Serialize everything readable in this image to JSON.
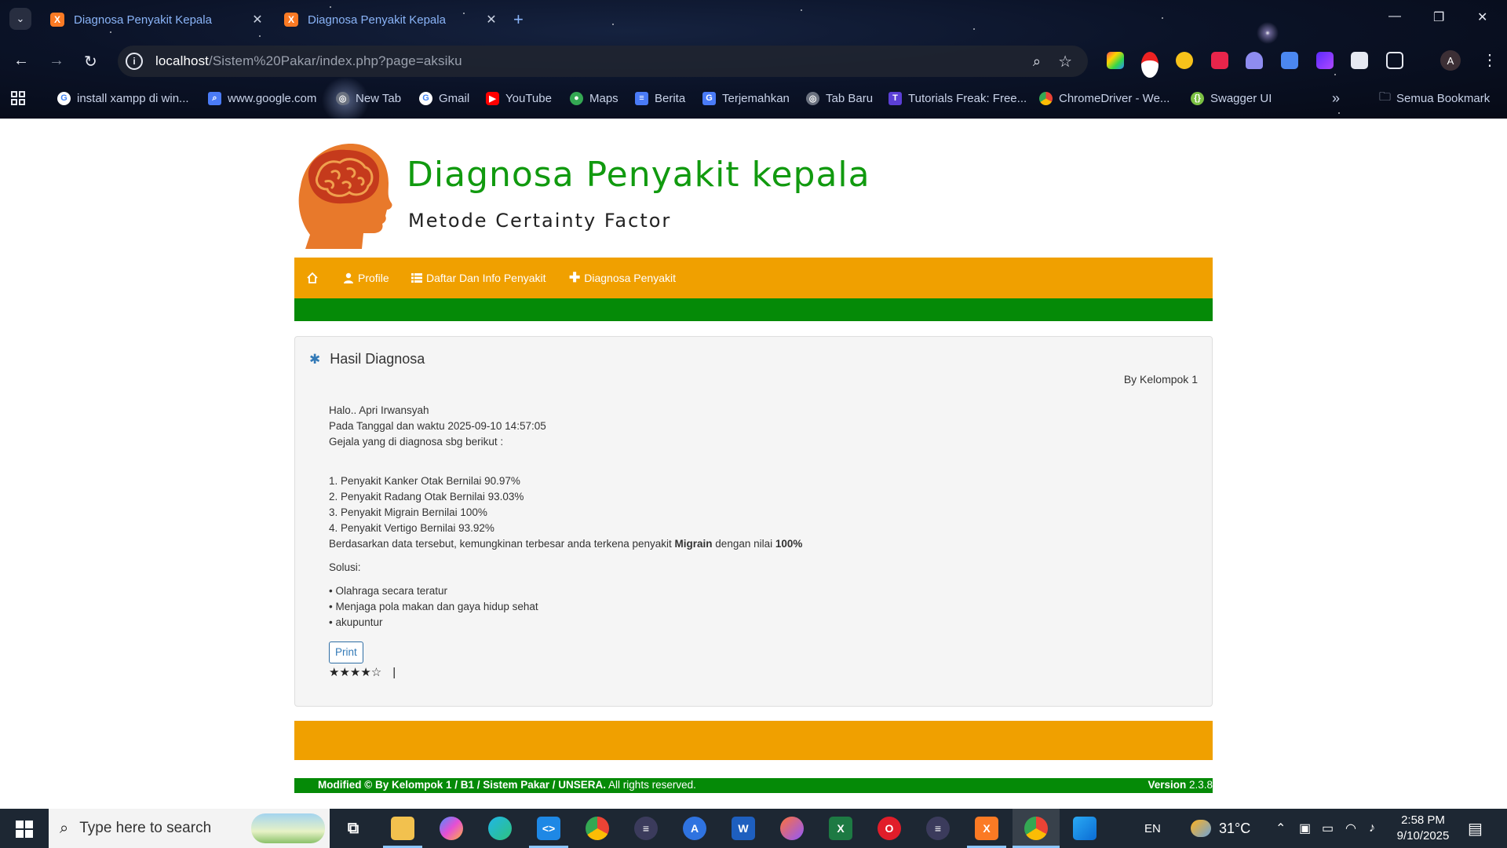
{
  "browser": {
    "tabs": [
      {
        "title": "Diagnosa Penyakit Kepala",
        "active": true
      },
      {
        "title": "Diagnosa Penyakit Kepala",
        "active": false
      }
    ],
    "url_host": "localhost",
    "url_path": "/Sistem%20Pakar/index.php?page=aksiku",
    "profile_initial": "A",
    "bookmarks": [
      {
        "label": "install xampp di win...",
        "icon": "google-icon"
      },
      {
        "label": "www.google.com",
        "icon": "search-icon"
      },
      {
        "label": "New Tab",
        "icon": "globe-icon"
      },
      {
        "label": "Gmail",
        "icon": "google-icon"
      },
      {
        "label": "YouTube",
        "icon": "youtube-icon"
      },
      {
        "label": "Maps",
        "icon": "maps-icon"
      },
      {
        "label": "Berita",
        "icon": "news-icon"
      },
      {
        "label": "Terjemahkan",
        "icon": "translate-icon"
      },
      {
        "label": "Tab Baru",
        "icon": "globe-icon"
      },
      {
        "label": "Tutorials Freak: Free...",
        "icon": "tutorials-icon"
      },
      {
        "label": "ChromeDriver - We...",
        "icon": "chrome-icon"
      },
      {
        "label": "Swagger UI",
        "icon": "swagger-icon"
      }
    ],
    "all_bookmarks": "Semua Bookmark"
  },
  "site": {
    "title": "Diagnosa Penyakit kepala",
    "subtitle": "Metode Certainty Factor",
    "nav": {
      "profile": "Profile",
      "list": "Daftar Dan Info Penyakit",
      "diagnose": "Diagnosa Penyakit"
    }
  },
  "result": {
    "heading": "Hasil Diagnosa",
    "byline": "By Kelompok 1",
    "greeting": "Halo.. Apri Irwansyah",
    "datetime": "Pada Tanggal dan waktu 2025-09-10 14:57:05",
    "symptoms_intro": "Gejala yang di diagnosa sbg berikut :",
    "diseases": [
      "1. Penyakit Kanker Otak Bernilai 90.97%",
      "2. Penyakit Radang Otak Bernilai 93.03%",
      "3. Penyakit Migrain Bernilai 100%",
      "4. Penyakit Vertigo Bernilai 93.92%"
    ],
    "conclusion_prefix": "Berdasarkan data tersebut, kemungkinan terbesar anda terkena penyakit ",
    "conclusion_disease": "Migrain",
    "conclusion_middle": " dengan nilai ",
    "conclusion_value": "100%",
    "solution_label": "Solusi:",
    "solutions": [
      "• Olahraga secara teratur",
      "• Menjaga pola makan dan gaya hidup sehat",
      "• akupuntur"
    ],
    "print_label": "Print",
    "rating": 4,
    "rating_max": 5,
    "rating_text": "★★★★☆",
    "rating_separator": "|"
  },
  "footer": {
    "copyright_bold": "Modified © By Kelompok 1 / B1 / Sistem Pakar / UNSERA.",
    "copyright_rest": " All rights reserved.",
    "version_label": "Version",
    "version_value": " 2.3.8"
  },
  "taskbar": {
    "search_placeholder": "Type here to search",
    "language": "EN",
    "temperature": "31°C",
    "time": "2:58 PM",
    "date": "9/10/2025"
  }
}
